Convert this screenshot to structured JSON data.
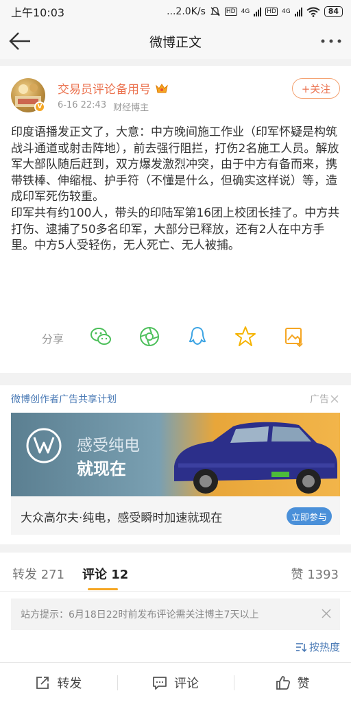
{
  "status_bar": {
    "time": "上午10:03",
    "network_speed": "...2.0K/s",
    "hd1": "HD",
    "net1": "4G",
    "hd2": "HD",
    "net2": "4G",
    "battery": "84"
  },
  "header": {
    "title": "微博正文"
  },
  "post": {
    "username": "交易员评论备用号",
    "timestamp": "6-16 22:43",
    "source": "财经博主",
    "follow_label": "+关注",
    "verified_badge": "V",
    "paragraph1": "印度语播发正文了，大意：中方晚间施工作业（印军怀疑是构筑战斗通道或射击阵地），前去强行阻拦，打伤2名施工人员。解放军大部队随后赶到，双方爆发激烈冲突，由于中方有备而来，携带铁棒、伸缩棍、护手符（不懂是什么，但确实这样说）等，造成印军死伤较重。",
    "paragraph2": "印军共有约100人，带头的印陆军第16团上校团长挂了。中方共打伤、逮捕了50多名印军，大部分已释放，还有2人在中方手里。中方5人受轻伤，无人死亡、无人被捕。",
    "share_label": "分享",
    "share_icons": [
      "wechat-icon",
      "moments-icon",
      "qq-icon",
      "qzone-icon",
      "save-image-icon"
    ]
  },
  "ad": {
    "header": "微博创作者广告共享计划",
    "tag": "广告",
    "slogan_line1": "感受纯电",
    "slogan_line2": "就现在",
    "caption": "大众高尔夫·纯电，感受瞬时加速就现在",
    "cta": "立即参与",
    "colors": {
      "cta_bg": "#4a90d9",
      "car": "#2c2f8a"
    }
  },
  "tabs": {
    "repost": "转发 271",
    "comment": "评论 12",
    "likes": "赞 1393"
  },
  "comments": {
    "notice": "站方提示：6月18日22时前发布评论需关注博主7天以上",
    "sort_label": "按热度"
  },
  "bottom_bar": {
    "repost": "转发",
    "comment": "评论",
    "like": "赞"
  },
  "colors": {
    "accent": "#eb7350",
    "link": "#4a7ab5",
    "tab_indicator": "#f5a623"
  }
}
